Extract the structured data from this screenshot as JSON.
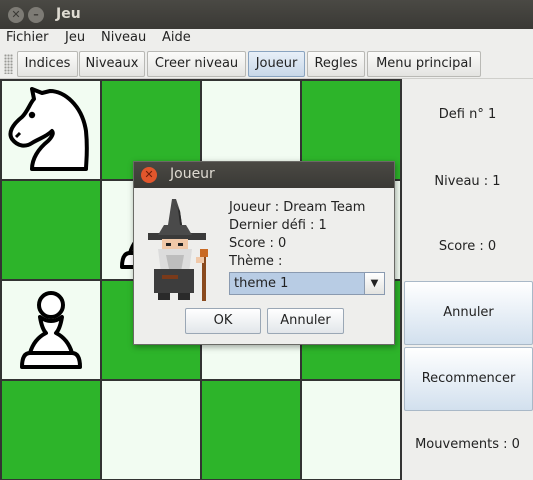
{
  "window": {
    "title": "Jeu",
    "close_glyph": "✕",
    "minimize_glyph": "–"
  },
  "menu": [
    "Fichier",
    "Jeu",
    "Niveau",
    "Aide"
  ],
  "toolbar": [
    "Indices",
    "Niveaux",
    "Creer niveau",
    "Joueur",
    "Regles",
    "Menu principal"
  ],
  "board": {
    "light_color": "#f2fcf2",
    "dark_color": "#2db42a",
    "cells": [
      [
        "w",
        "g",
        "w",
        "g"
      ],
      [
        "g",
        "w",
        "g",
        "w"
      ],
      [
        "w",
        "g",
        "w",
        "g"
      ],
      [
        "g",
        "w",
        "g",
        "w"
      ]
    ],
    "pieces": [
      {
        "piece": "knight-icon",
        "row": 0,
        "col": 0
      },
      {
        "piece": "pawn-icon",
        "row": 1,
        "col": 1
      },
      {
        "piece": "pawn-icon",
        "row": 2,
        "col": 0
      }
    ]
  },
  "side": {
    "defi": "Defi n° 1",
    "niveau": "Niveau : 1",
    "score": "Score : 0",
    "annuler": "Annuler",
    "recommencer": "Recommencer",
    "mouvements": "Mouvements : 0"
  },
  "dialog": {
    "title": "Joueur",
    "close_glyph": "✕",
    "avatar": "wizard-icon",
    "joueur": "Joueur : Dream Team",
    "dernier_defi": "Dernier défi : 1",
    "score": "Score : 0",
    "theme_label": "Thème :",
    "theme_value": "theme 1",
    "theme_arrow": "▼",
    "ok": "OK",
    "annuler": "Annuler"
  }
}
